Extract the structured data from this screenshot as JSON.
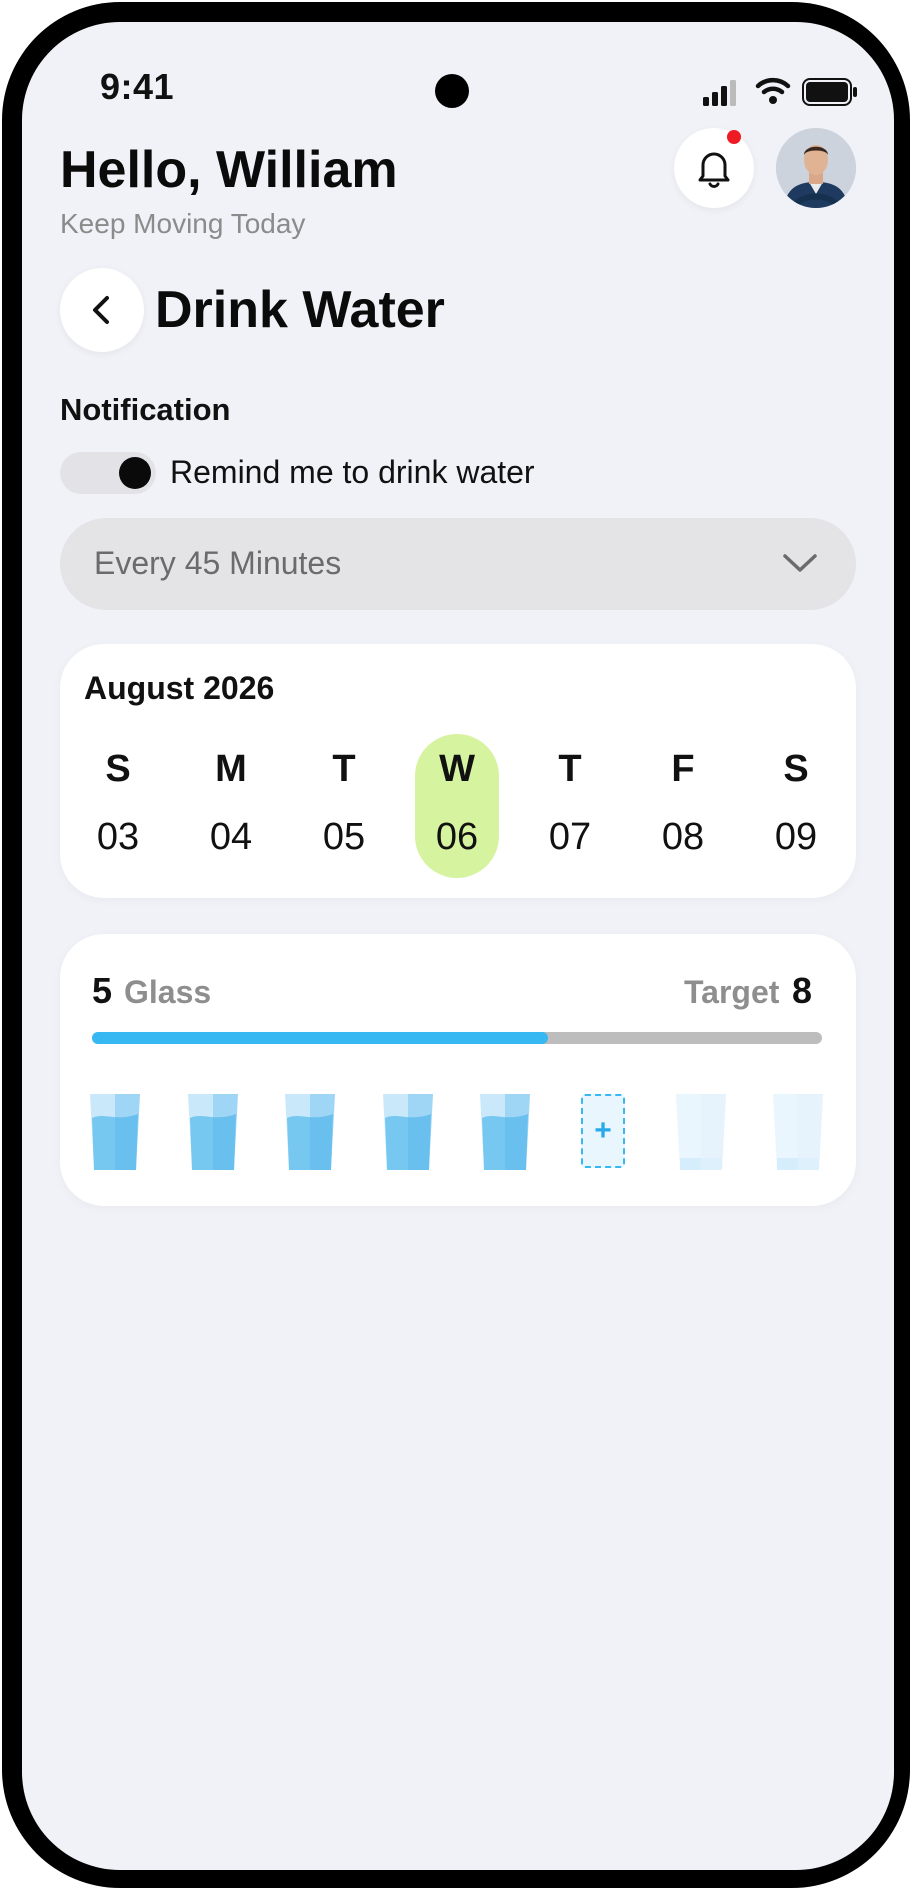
{
  "status_bar": {
    "time": "9:41"
  },
  "header": {
    "greeting": "Hello, William",
    "subtitle": "Keep Moving Today"
  },
  "page": {
    "title": "Drink Water"
  },
  "notification": {
    "section_label": "Notification",
    "toggle_label": "Remind me to drink water",
    "toggle_on": true,
    "interval": "Every 45 Minutes"
  },
  "calendar": {
    "month": "August 2026",
    "days": [
      {
        "letter": "S",
        "num": "03",
        "selected": false
      },
      {
        "letter": "M",
        "num": "04",
        "selected": false
      },
      {
        "letter": "T",
        "num": "05",
        "selected": false
      },
      {
        "letter": "W",
        "num": "06",
        "selected": true
      },
      {
        "letter": "T",
        "num": "07",
        "selected": false
      },
      {
        "letter": "F",
        "num": "08",
        "selected": false
      },
      {
        "letter": "S",
        "num": "09",
        "selected": false
      }
    ],
    "selected_color": "#d6f3a0"
  },
  "water": {
    "count": "5",
    "unit": "Glass",
    "target_label": "Target",
    "target": "8",
    "progress": 0.625,
    "accent_color": "#38b8f3",
    "glasses": [
      "filled",
      "filled",
      "filled",
      "filled",
      "filled",
      "add",
      "empty",
      "empty"
    ]
  }
}
